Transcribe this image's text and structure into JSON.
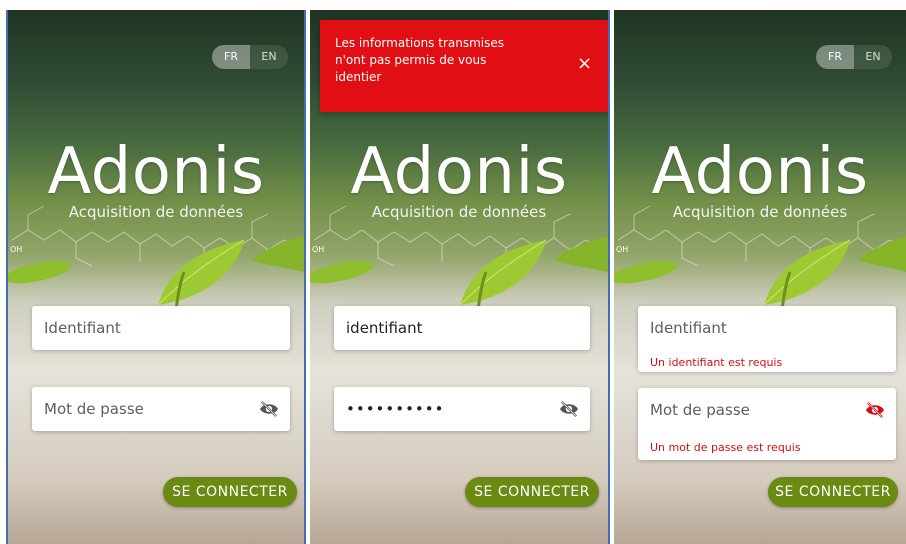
{
  "lang": {
    "fr": "FR",
    "en": "EN"
  },
  "app": {
    "title": "Adonis",
    "subtitle": "Acquisition de données"
  },
  "panels": [
    {
      "login_placeholder": "Identifiant",
      "password_placeholder": "Mot de passe",
      "submit": "SE CONNECTER"
    },
    {
      "toast": "Les informations transmises\nn'ont pas permis de vous\nidentier",
      "toast_close": "×",
      "login_value": "identifiant",
      "password_dots": "••••••••••",
      "submit": "SE CONNECTER"
    },
    {
      "login_placeholder": "Identifiant",
      "login_error": "Un identifiant est requis",
      "password_placeholder": "Mot de passe",
      "password_error": "Un mot de passe est requis",
      "submit": "SE CONNECTER"
    }
  ],
  "colors": {
    "accent": "#6a8a12",
    "error": "#d40f14",
    "toast": "#e10e14"
  }
}
